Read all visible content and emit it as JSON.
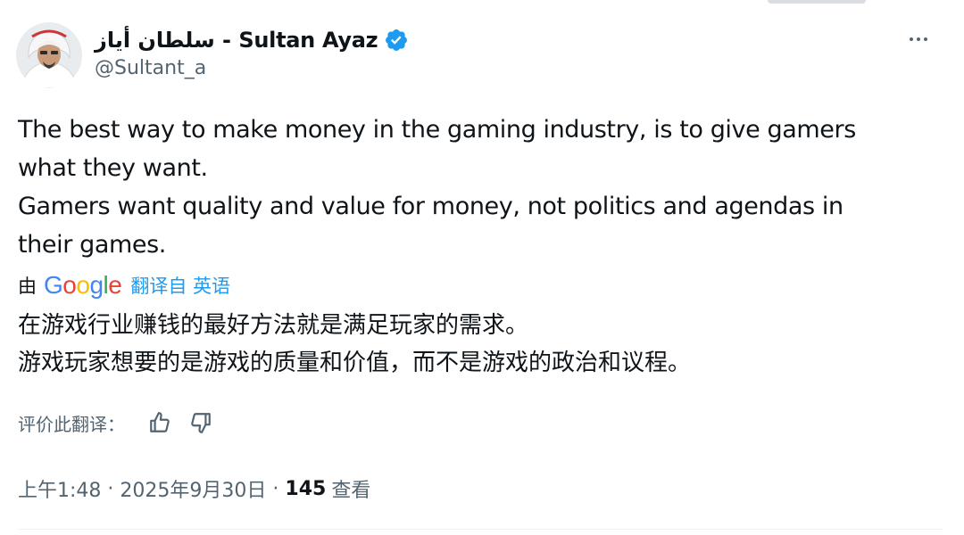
{
  "tweet": {
    "author": {
      "display_name": "سلطان أياز - Sultan Ayaz",
      "handle": "@Sultant_a",
      "verified": true,
      "verified_color": "#1d9bf0"
    },
    "text_lines": [
      "The best way to make money in the gaming industry, is to give gamers",
      "what they want.",
      "Gamers want quality and value for money, not politics and agendas in",
      "their games."
    ],
    "translation": {
      "by_label": "由",
      "provider": "Google",
      "link_label": "翻译自 英语",
      "lines": [
        "在游戏行业赚钱的最好方法就是满足玩家的需求。",
        "游戏玩家想要的是游戏的质量和价值，而不是游戏的政治和议程。"
      ],
      "rate_label": "评价此翻译："
    },
    "meta": {
      "time": "上午1:48",
      "date": "2025年9月30日",
      "separator": "·",
      "views_count": "145",
      "views_label": "查看"
    }
  },
  "colors": {
    "text_primary": "#0f1419",
    "text_secondary": "#536471",
    "accent": "#1d9bf0",
    "divider": "#eff3f4"
  },
  "icons": {
    "more": "more-horizontal-icon",
    "verified": "verified-badge-icon",
    "thumbs_up": "thumbs-up-icon",
    "thumbs_down": "thumbs-down-icon"
  }
}
